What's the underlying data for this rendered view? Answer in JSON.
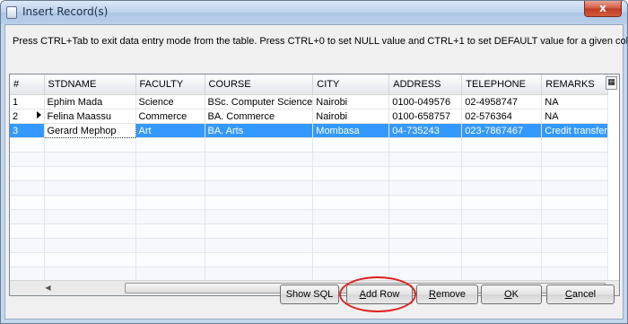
{
  "window": {
    "title": "Insert Record(s)",
    "close_glyph": "x"
  },
  "instructions": "Press CTRL+Tab to exit data entry mode from the table. Press CTRL+0 to set NULL value and CTRL+1 to set DEFAULT value for a given column.",
  "table": {
    "columns": [
      "#",
      "STDNAME",
      "FACULTY",
      "COURSE",
      "CITY",
      "ADDRESS",
      "TELEPHONE",
      "REMARKS"
    ],
    "rows": [
      [
        "1",
        "Ephim Mada",
        "Science",
        "BSc. Computer Science",
        "Nairobi",
        "0100-049576",
        "02-4958747",
        "NA"
      ],
      [
        "2",
        "Felina Maassu",
        "Commerce",
        "BA. Commerce",
        "Nairobi",
        "0100-658757",
        "02-576364",
        "NA"
      ],
      [
        "3",
        "Gerard Mephop",
        "Art",
        "BA. Arts",
        "Mombasa",
        "04-735243",
        "023-7867467",
        "Credit transfer"
      ]
    ],
    "selected_row": 3
  },
  "buttons": {
    "show_sql": "Show SQL",
    "add_row_key": "A",
    "add_row_rest": "dd Row",
    "remove_key": "R",
    "remove_rest": "emove",
    "ok_key": "O",
    "ok_rest": "K",
    "cancel_key": "C",
    "cancel_rest": "ancel"
  },
  "colors": {
    "selection": "#3399ff",
    "highlight_ellipse": "#e02020"
  }
}
